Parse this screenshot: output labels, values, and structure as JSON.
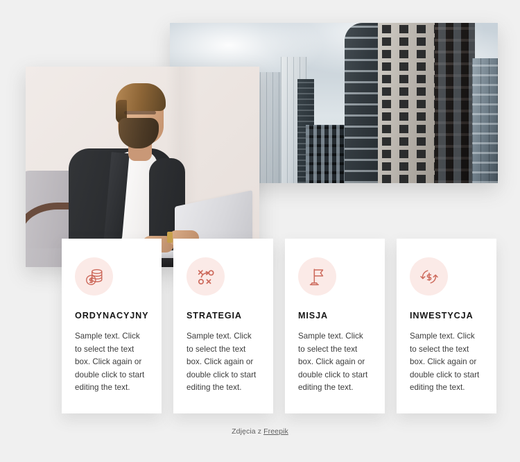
{
  "page": {
    "background_color": "#f0f0f0"
  },
  "media": {
    "city_photo": {
      "name": "city-skyscrapers-photo",
      "alt": "City skyline with modern office skyscrapers under a cloudy sky"
    },
    "man_photo": {
      "name": "businessman-laptop-photo",
      "alt": "Bearded businessman in a dark blazer working on a laptop while seated in an armchair"
    }
  },
  "cards": [
    {
      "icon": "coins-stack-dollar-icon",
      "title": "ORDYNACYJNY",
      "body": "Sample text. Click to select the text box. Click again or double click to start editing the text."
    },
    {
      "icon": "strategy-playbook-icon",
      "title": "STRATEGIA",
      "body": "Sample text. Click to select the text box. Click again or double click to start editing the text."
    },
    {
      "icon": "flag-icon",
      "title": "MISJA",
      "body": "Sample text. Click to select the text box. Click again or double click to start editing the text."
    },
    {
      "icon": "dollar-refresh-cycle-icon",
      "title": "INWESTYCJA",
      "body": "Sample text. Click to select the text box. Click again or double click to start editing the text."
    }
  ],
  "footer": {
    "prefix": "Zdjęcia z ",
    "link_label": "Freepik"
  },
  "colors": {
    "accent": "#cd6a5c",
    "icon_circle_bg": "#fbeae7",
    "card_bg": "#ffffff",
    "title": "#161616",
    "body_text": "#3b3b3b",
    "page_bg": "#f0f0f0"
  }
}
